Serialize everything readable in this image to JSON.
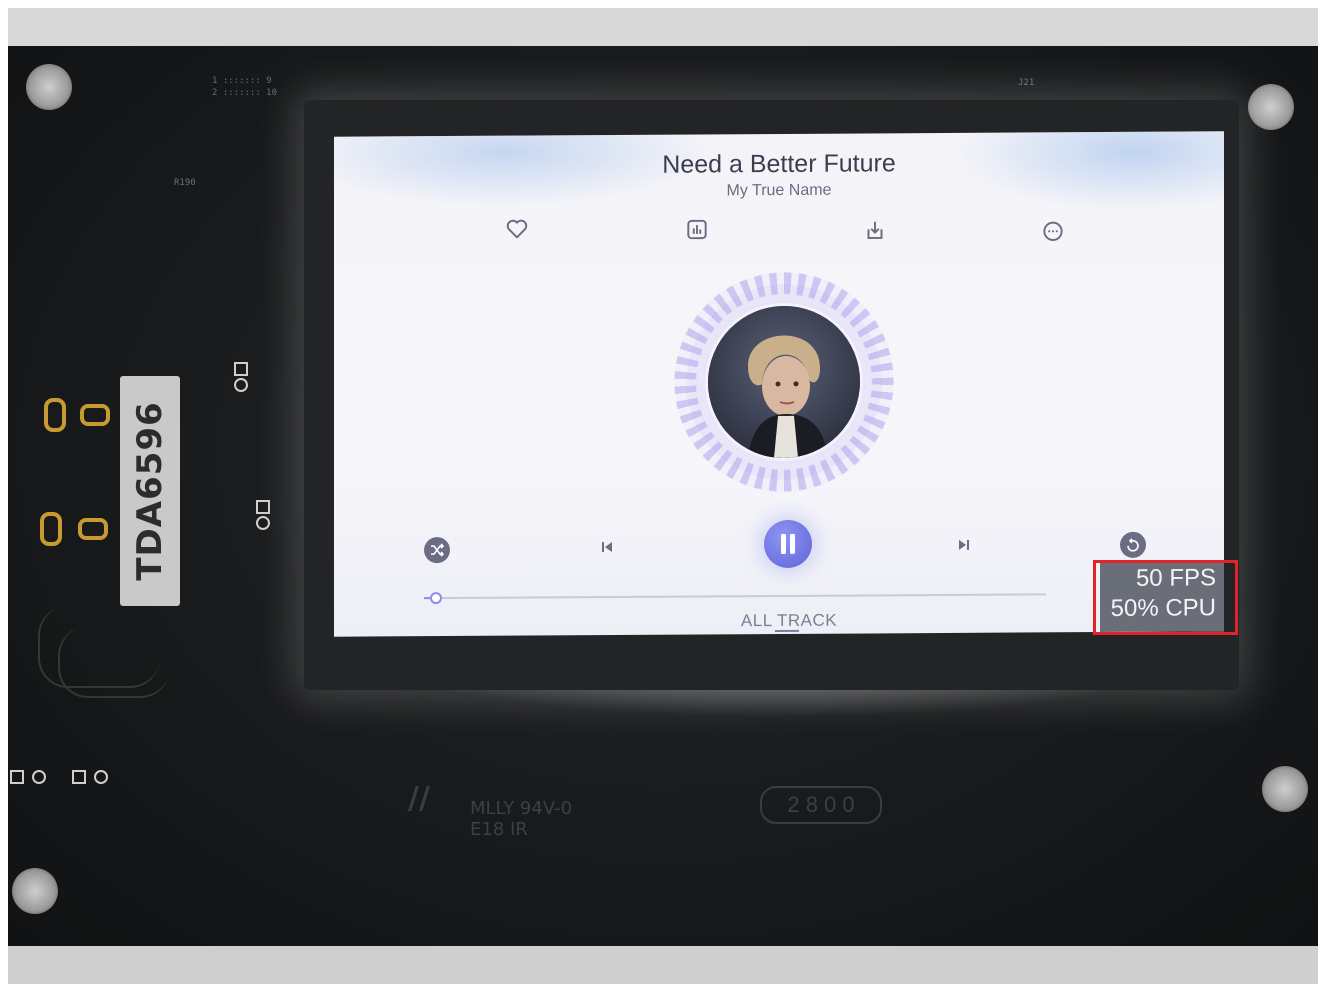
{
  "player": {
    "title": "Need a Better Future",
    "artist": "My True Name",
    "top_icons": [
      {
        "name": "heart-icon"
      },
      {
        "name": "equalizer-icon"
      },
      {
        "name": "download-icon"
      },
      {
        "name": "chat-icon"
      }
    ],
    "progress": 0.02,
    "all_track_label": "ALL TRACK",
    "controls": {
      "shuffle": "shuffle-icon",
      "previous": "skip-previous-icon",
      "play_pause": "pause-icon",
      "next": "skip-next-icon",
      "repeat": "repeat-icon"
    },
    "accent_color": "#6f74e2"
  },
  "perf_monitor": {
    "fps": "50 FPS",
    "cpu": "50% CPU"
  },
  "board": {
    "chip_label": "TDA6596",
    "ul_mark": "MLLY 94V-0",
    "ul_sub": "E18 IR",
    "date_code": "2 8 0  0"
  },
  "annotation": {
    "highlight_color": "#e0242a"
  }
}
